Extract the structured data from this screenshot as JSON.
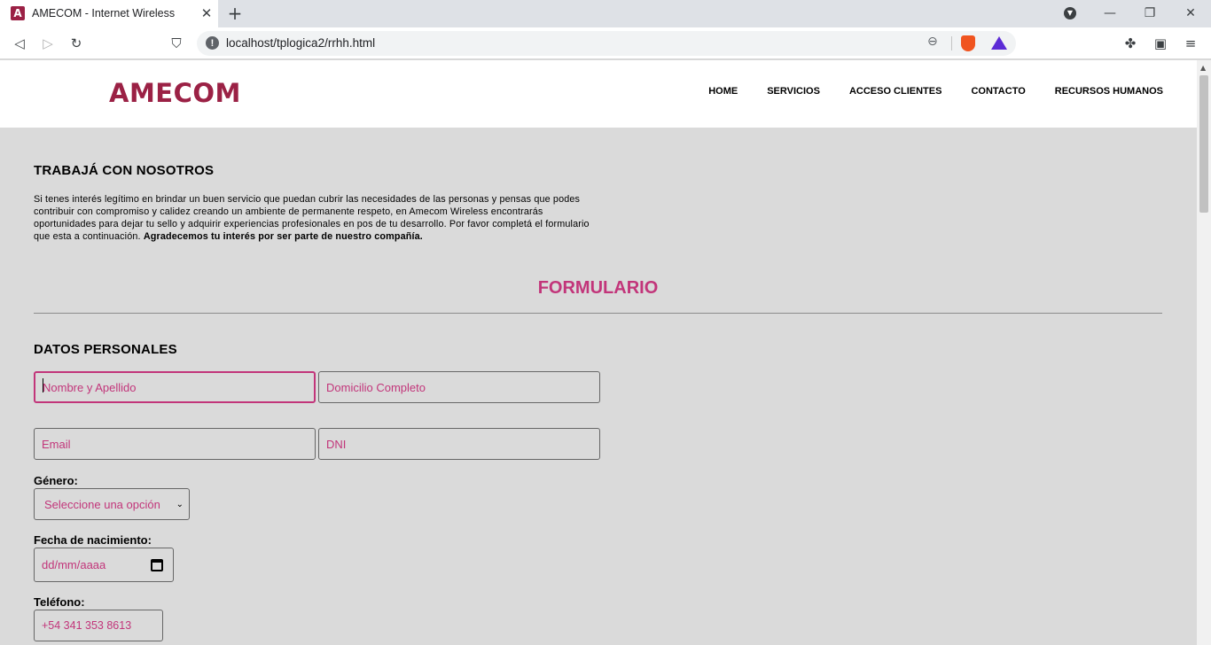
{
  "browser": {
    "tab_title": "AMECOM - Internet Wireless",
    "tab_favicon_letter": "A",
    "url": "localhost/tplogica2/rrhh.html"
  },
  "site": {
    "logo": "AMECOM",
    "nav": [
      "HOME",
      "SERVICIOS",
      "ACCESO CLIENTES",
      "CONTACTO",
      "RECURSOS HUMANOS"
    ]
  },
  "content": {
    "work_heading": "TRABAJÁ CON NOSOTROS",
    "intro_text": "Si tenes interés legítimo en brindar un buen servicio que puedan cubrir las necesidades de las personas y pensas que podes contribuir con compromiso y calidez creando un ambiente de permanente respeto, en Amecom Wireless encontrarás oportunidades para dejar tu sello y adquirir experiencias profesionales en pos de tu desarrollo. Por favor completá el formulario que esta a continuación.",
    "intro_bold": "Agradecemos tu interés por ser parte de nuestro compañía.",
    "form_title": "FORMULARIO",
    "personal_heading": "DATOS PERSONALES"
  },
  "form": {
    "name_placeholder": "Nombre y Apellido",
    "address_placeholder": "Domicilio Completo",
    "email_placeholder": "Email",
    "dni_placeholder": "DNI",
    "gender_label": "Género:",
    "gender_selected": "Seleccione una opción",
    "birth_label": "Fecha de nacimiento:",
    "birth_placeholder": "dd/mm/aaaa",
    "phone_label": "Teléfono:",
    "phone_placeholder": "+54 341 353 8613"
  },
  "colors": {
    "brand": "#9b2145",
    "accent": "#c2357a",
    "page_bg": "#dadada"
  }
}
